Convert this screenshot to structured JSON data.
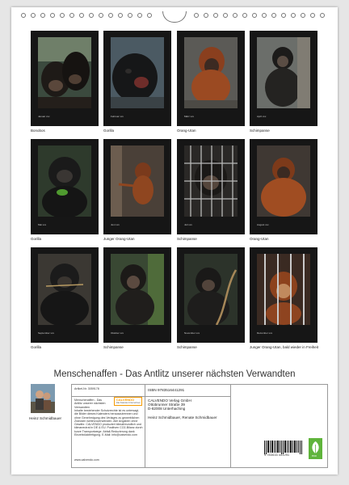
{
  "colors": {
    "page_bg": "#ffffff",
    "thumb_frame": "#161616",
    "eco_green": "#5fb43b",
    "calvendo_orange": "#f59a00"
  },
  "thumbnails": [
    {
      "month": "Januar xxx",
      "caption": "Bonobos"
    },
    {
      "month": "Februar xxx",
      "caption": "Gorilla"
    },
    {
      "month": "März xxx",
      "caption": "Orang-Utan"
    },
    {
      "month": "April xxx",
      "caption": "Schimpanse"
    },
    {
      "month": "Mai xxx",
      "caption": "Gorilla"
    },
    {
      "month": "Juni xxx",
      "caption": "Junger Orang-Utan"
    },
    {
      "month": "Juli xxx",
      "caption": "Schimpanse"
    },
    {
      "month": "August xxx",
      "caption": "Orang-Utan"
    },
    {
      "month": "September xxx",
      "caption": "Gorilla"
    },
    {
      "month": "Oktober xxx",
      "caption": "Schimpanse"
    },
    {
      "month": "November xxx",
      "caption": "Schimpanse"
    },
    {
      "month": "Dezember xxx",
      "caption": "Junger Orang-Utan, bald wieder in Freiheit"
    }
  ],
  "title": "Menschenaffen - Das Antlitz unserer nächsten Verwandten",
  "author_photo_label": "Heinz Schmidbauer",
  "info": {
    "article": "Artikel-Nr. 3059178",
    "product": "Menschenaffen - Das Antlitz unserer nächsten Verwandten",
    "calvendo_logo": "CALVENDO",
    "calvendo_sub": "Das Kalender-Unternehmen",
    "isbn": "ISBN 9783516441291",
    "publisher_lines": [
      "CALVENDO Verlag GmbH",
      "Ottobrunner Straße 39",
      "D-82008 Unterhaching"
    ],
    "authors": "Heinz Schmidbauer, Renate Schmidbauer",
    "legal": "Inhalte bestehender Schutzrechte ist es untersagt, die Bilder dieses Kalenders herauszutrennen und ohne Genehmigung des Verlages zu gewerblichen Zwecken weiterzuverwenden. Alle Angaben ohne Gewähr. CALVENDO produziert klimafreundlich und klimaneutral in DE & EU. Positiven CO2-Bilanz durch kurze Transportwege. Abfall-Reduzierung dank Einzelstückfertigung. E-Mail: info@calvendo.com",
    "website": "www.calvendo.com",
    "barcode_number": "9 783516 441291",
    "eco_label": "eco"
  }
}
